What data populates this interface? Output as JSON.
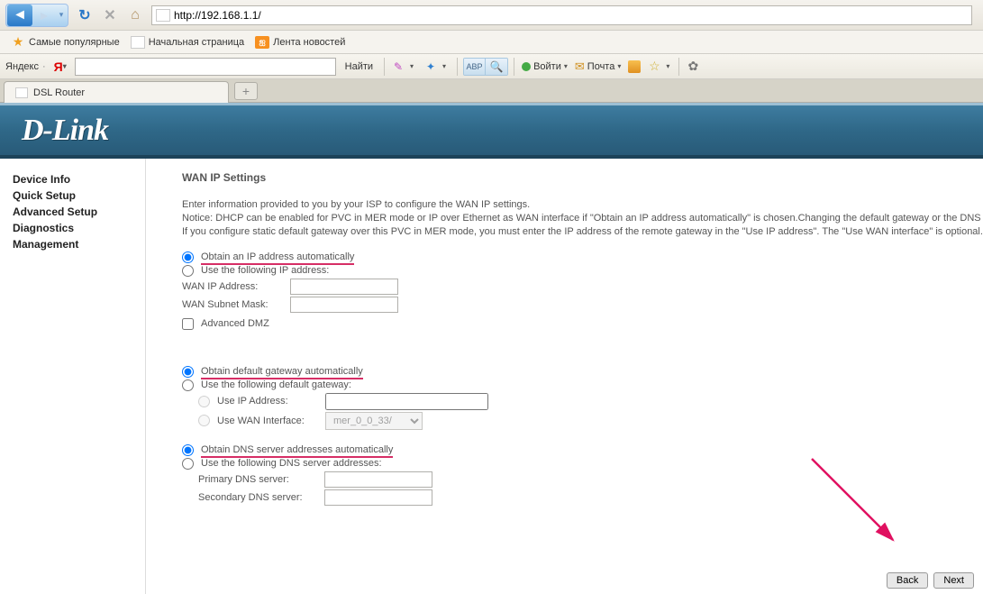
{
  "browser": {
    "url": "http://192.168.1.1/",
    "bookmarks": [
      {
        "label": "Самые популярные",
        "icon": "star"
      },
      {
        "label": "Начальная страница",
        "icon": "page"
      },
      {
        "label": "Лента новостей",
        "icon": "rss"
      }
    ],
    "yandex_label": "Яндекс",
    "find_label": "Найти",
    "login_label": "Войти",
    "mail_label": "Почта"
  },
  "tab": {
    "title": "DSL Router"
  },
  "brand": "D-Link",
  "sidebar": {
    "items": [
      "Device Info",
      "Quick Setup",
      "Advanced Setup",
      "Diagnostics",
      "Management"
    ]
  },
  "page": {
    "title": "WAN IP Settings",
    "desc1": "Enter information provided to you by your ISP to configure the WAN IP settings.",
    "desc2": "Notice: DHCP can be enabled for PVC in MER mode or IP over Ethernet as WAN interface if \"Obtain an IP address automatically\" is chosen.Changing the default gateway or the DNS effects the whole system. Configuring them with static values will disable the automatic assignment from DHCP or other WAN connection.",
    "desc3": "If you configure static default gateway over this PVC in MER mode, you must enter the IP address of the remote gateway in the \"Use IP address\". The \"Use WAN interface\" is optional.",
    "ip_auto": "Obtain an IP address automatically",
    "ip_static": "Use the following IP address:",
    "wan_ip_lbl": "WAN IP Address:",
    "wan_mask_lbl": "WAN Subnet Mask:",
    "adv_dmz": "Advanced DMZ",
    "gw_auto": "Obtain default gateway automatically",
    "gw_static": "Use the following default gateway:",
    "use_ip_addr": "Use IP Address:",
    "use_wan_if": "Use WAN Interface:",
    "wan_if_sel": "mer_0_0_33/",
    "dns_auto": "Obtain DNS server addresses automatically",
    "dns_static": "Use the following DNS server addresses:",
    "dns_primary": "Primary DNS server:",
    "dns_secondary": "Secondary DNS server:",
    "back": "Back",
    "next": "Next"
  }
}
